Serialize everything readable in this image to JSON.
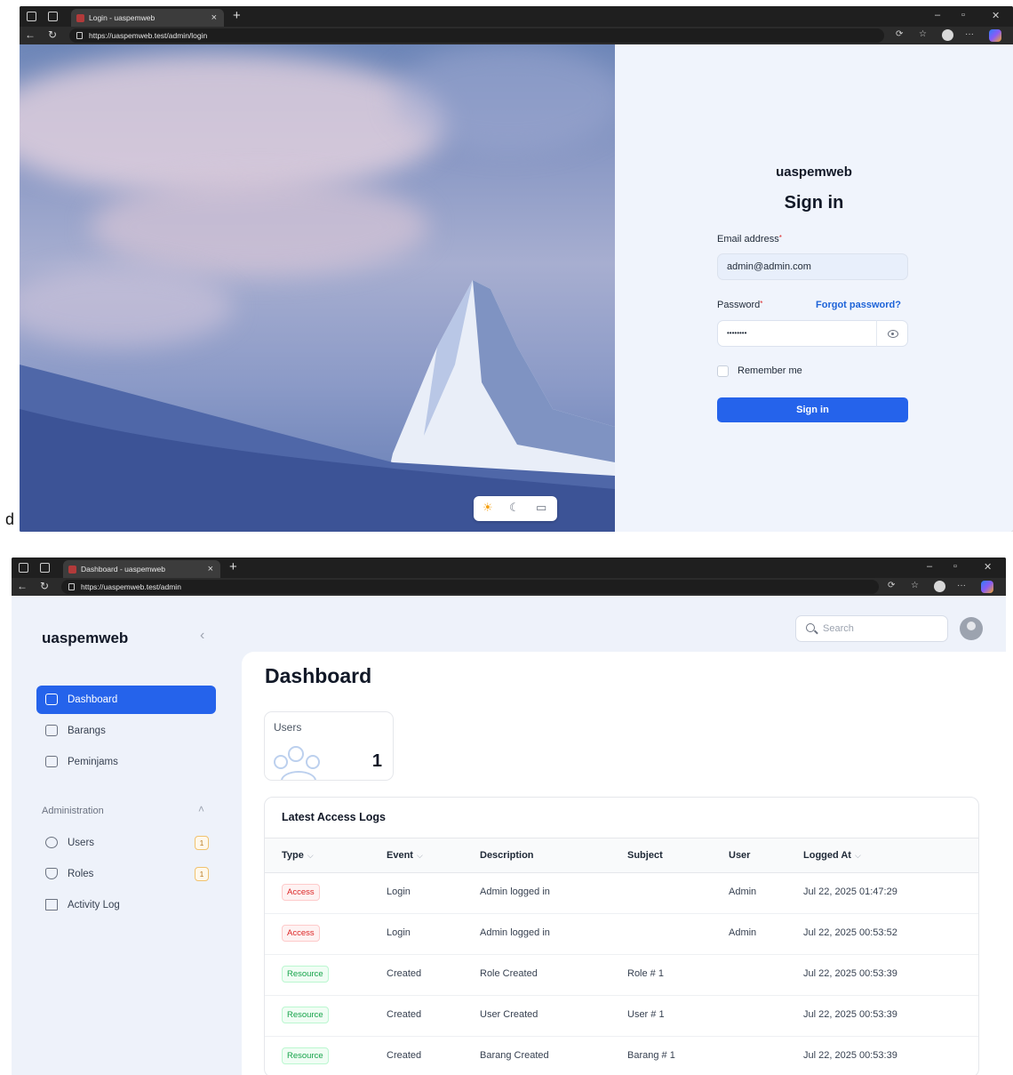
{
  "login_window": {
    "tab_title": "Login - uaspemweb",
    "url": "https://uaspemweb.test/admin/login",
    "brand": "uaspemweb",
    "heading": "Sign in",
    "email_label": "Email address",
    "email_value": "admin@admin.com",
    "password_label": "Password",
    "password_value": "••••••••",
    "forgot_link": "Forgot password?",
    "remember_label": "Remember me",
    "submit_label": "Sign in",
    "theme_options": [
      "sun-icon",
      "moon-icon",
      "monitor-icon"
    ],
    "stray_text": "d"
  },
  "dashboard_window": {
    "tab_title": "Dashboard - uaspemweb",
    "url": "https://uaspemweb.test/admin",
    "brand": "uaspemweb",
    "search_placeholder": "Search",
    "nav": [
      {
        "label": "Dashboard",
        "icon": "home-icon",
        "active": true
      },
      {
        "label": "Barangs",
        "icon": "box-icon"
      },
      {
        "label": "Peminjams",
        "icon": "box-icon"
      }
    ],
    "group": "Administration",
    "admin_nav": [
      {
        "label": "Users",
        "icon": "users-icon",
        "count": "1"
      },
      {
        "label": "Roles",
        "icon": "shield-icon",
        "count": "1"
      },
      {
        "label": "Activity Log",
        "icon": "document-icon"
      }
    ],
    "page_title": "Dashboard",
    "stat": {
      "label": "Users",
      "value": "1"
    },
    "table": {
      "title": "Latest Access Logs",
      "columns": [
        "Type",
        "Event",
        "Description",
        "Subject",
        "User",
        "Logged At"
      ],
      "rows": [
        {
          "type": "Access",
          "event": "Login",
          "description": "Admin logged in",
          "subject": "",
          "user": "Admin",
          "logged_at": "Jul 22, 2025 01:47:29"
        },
        {
          "type": "Access",
          "event": "Login",
          "description": "Admin logged in",
          "subject": "",
          "user": "Admin",
          "logged_at": "Jul 22, 2025 00:53:52"
        },
        {
          "type": "Resource",
          "event": "Created",
          "description": "Role Created",
          "subject": "Role # 1",
          "user": "",
          "logged_at": "Jul 22, 2025 00:53:39"
        },
        {
          "type": "Resource",
          "event": "Created",
          "description": "User Created",
          "subject": "User # 1",
          "user": "",
          "logged_at": "Jul 22, 2025 00:53:39"
        },
        {
          "type": "Resource",
          "event": "Created",
          "description": "Barang Created",
          "subject": "Barang # 1",
          "user": "",
          "logged_at": "Jul 22, 2025 00:53:39"
        }
      ]
    }
  },
  "colors": {
    "primary": "#2563eb",
    "access_badge": "#dc2626",
    "resource_badge": "#16a34a",
    "chrome_dark": "#202124"
  }
}
